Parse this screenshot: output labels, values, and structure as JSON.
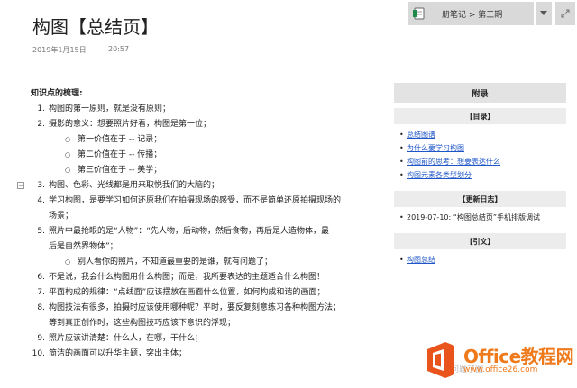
{
  "notebook_bar": {
    "breadcrumb": "一册笔记 > 第三期",
    "dropdown_icon": "caret-down-icon",
    "expand_icon": "expand-arrows-icon"
  },
  "page": {
    "title": "构图【总结页】",
    "date": "2019年1月15日",
    "time": "20:57"
  },
  "content": {
    "heading": "知识点的梳理:",
    "items": [
      {
        "num": "1.",
        "text": "构图的第一原则，就是没有原则；"
      },
      {
        "num": "2.",
        "text": "摄影的意义：想要照片好看，构图是第一位；"
      },
      {
        "sub": true,
        "text": "第一价值在于 -- 记录；"
      },
      {
        "sub": true,
        "text": "第二价值在于 -- 传播；"
      },
      {
        "sub": true,
        "text": "第三价值在于 -- 美学；"
      },
      {
        "num": "3.",
        "text": "构图、色彩、光线都是用来取悦我们的大脑的；"
      },
      {
        "num": "4.",
        "text": "学习构图，是要学习如何还原我们在拍摄现场的感受，而不是简单还原拍摄现场的"
      },
      {
        "cont": true,
        "text": "场景；"
      },
      {
        "num": "5.",
        "text": "照片中最抢眼的是“人物”：“先人物，后动物，然后食物，再后是人造物体，最"
      },
      {
        "cont": true,
        "text": "后是自然界物体”；"
      },
      {
        "sub": true,
        "text": "别人看你的照片，不知道最重要的是谁，就有问题了；"
      },
      {
        "num": "6.",
        "text": "不是说，我会什么构图用什么构图；而是，我所要表达的主题适合什么构图！"
      },
      {
        "num": "7.",
        "text": "平面构成的规律：“点线面”应该摆放在画面什么位置，如何构成和谐的画面；"
      },
      {
        "num": "8.",
        "text": "构图技法有很多，拍摄时应该使用哪种呢？平时，要反复刻意练习各种构图方法；"
      },
      {
        "cont": true,
        "text": "等到真正创作时，这些构图技巧应该下意识的浮现；"
      },
      {
        "num": "9.",
        "text": "照片应该讲清楚：什么人，在哪，干什么；"
      },
      {
        "num": "10.",
        "text": "简洁的画面可以升华主题，突出主体；"
      }
    ]
  },
  "appendix": {
    "header": "附录",
    "toc_title": "【目录】",
    "toc_links": [
      "总结图谱",
      "为什么要学习构图",
      "构图前的思考：想要表达什么",
      "构图元素各类型划分"
    ],
    "log_title": "【更新日志】",
    "log_entries": [
      "2019-07-10: “构图总结页”手机排版调试"
    ],
    "ref_title": "【引文】",
    "ref_links": [
      "构图总结"
    ]
  },
  "watermark": {
    "brand": "Office教程网",
    "url": "www.office26.com",
    "under_text": "问题了图"
  },
  "colors": {
    "link": "#1e56c7",
    "watermark": "#ee7a1c",
    "panel": "#e3e3e3",
    "toolbar": "#d9d9d9"
  }
}
